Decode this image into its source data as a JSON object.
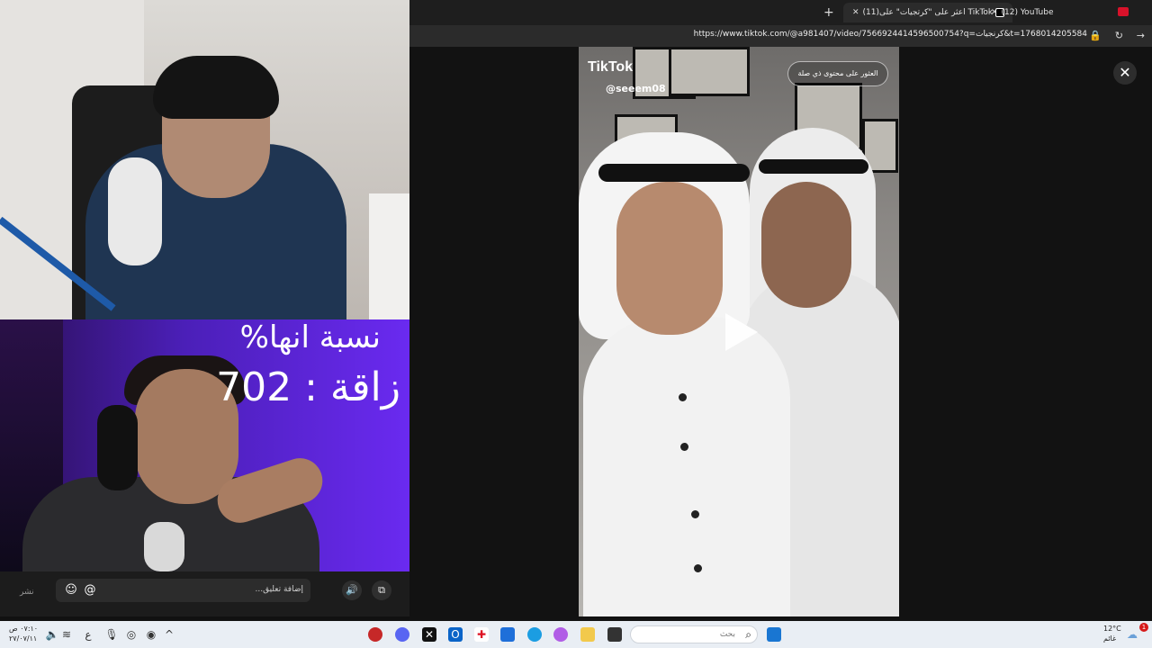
{
  "overlay": {
    "line1": "نسبة انها%",
    "line2": "زاقة  :  702"
  },
  "chat": {
    "side_label": "نشر",
    "placeholder": "إضافة تعليق..."
  },
  "browser": {
    "tabs": [
      {
        "label": "(12) YouTube",
        "active": false
      },
      {
        "label": "(11)اعثر على \"كرتجيات\" على TikTok",
        "active": true
      }
    ],
    "url": "https://www.tiktok.com/@a981407/video/7566924414596500754?q=كرنجيات&t=1768014205584"
  },
  "tiktok": {
    "logo": "TikTok",
    "username": "@seeem08",
    "related_button": "العثور على محتوى ذي صلة"
  },
  "taskbar": {
    "search_placeholder": "بحث",
    "clock_time": "٠٧:١٠ ص",
    "clock_date": "٢٧/٠٧/١١",
    "lang": "ع",
    "weather_temp": "12°C",
    "weather_desc": "غائم",
    "notification_count": "1"
  },
  "colors": {
    "accent_red": "#d8122a",
    "overlay_purple": "#4b1fb8"
  }
}
